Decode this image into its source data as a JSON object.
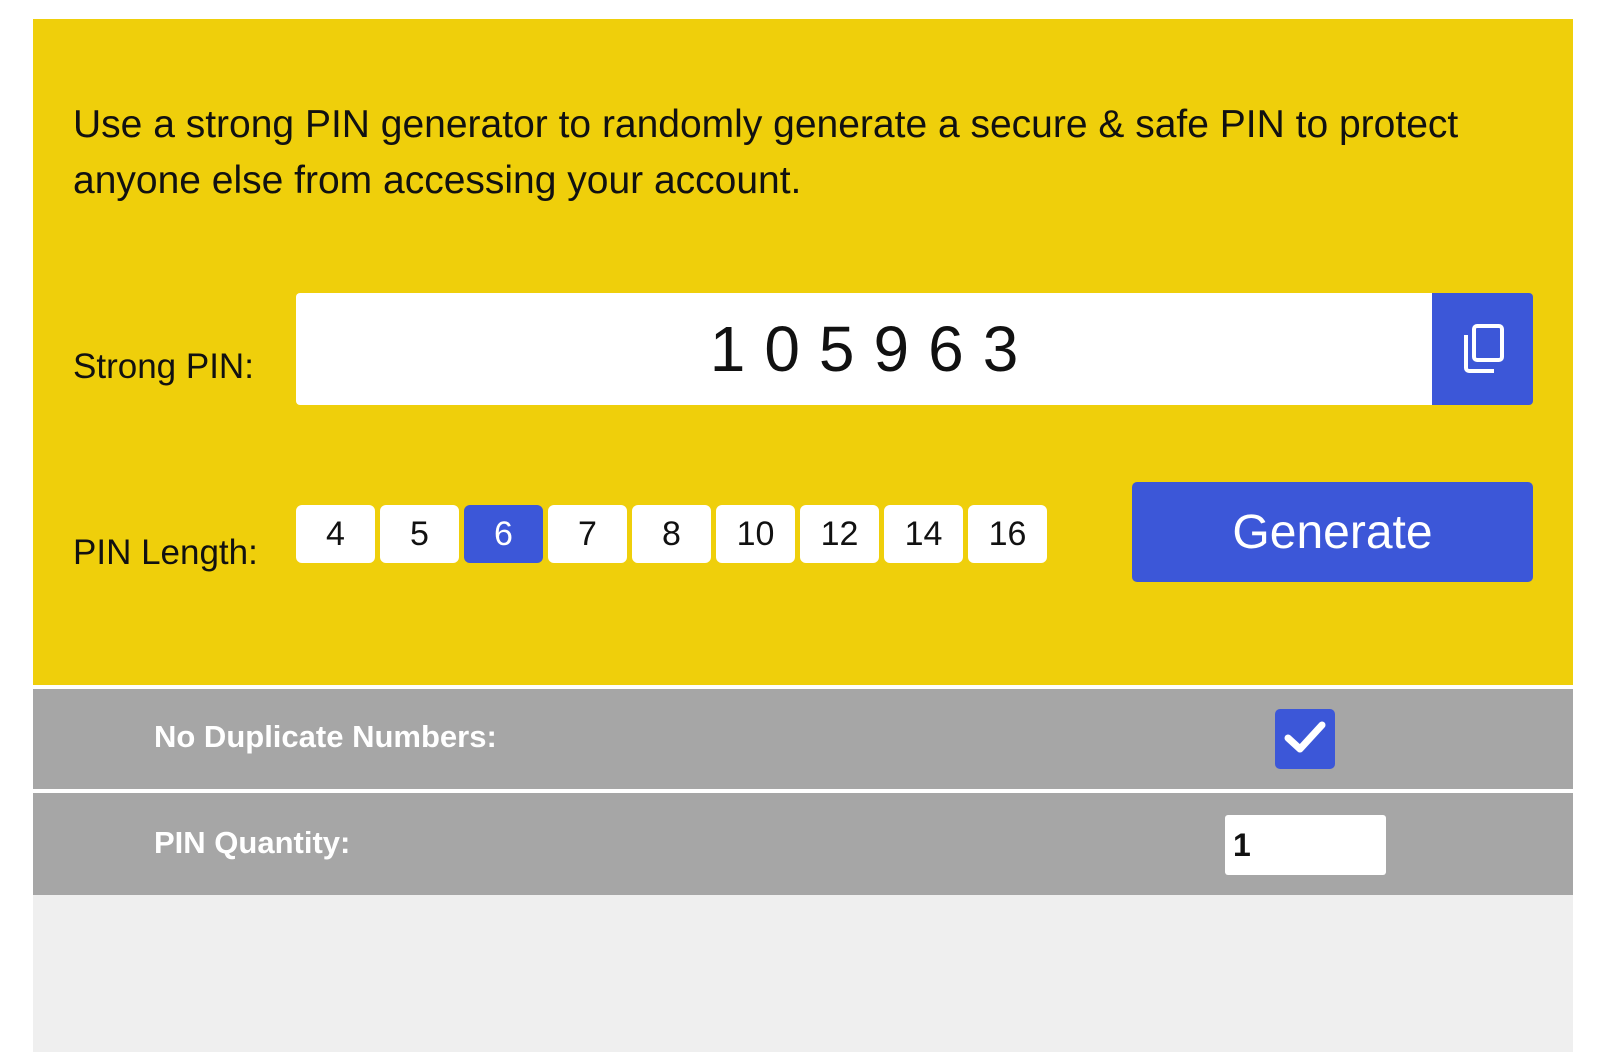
{
  "description": "Use a strong PIN generator to randomly generate a secure & safe PIN to protect anyone else from accessing your account.",
  "strong_pin": {
    "label": "Strong PIN:",
    "value": "105963",
    "copy_icon": "copy-icon"
  },
  "pin_length": {
    "label": "PIN Length:",
    "options": [
      "4",
      "5",
      "6",
      "7",
      "8",
      "10",
      "12",
      "14",
      "16"
    ],
    "selected": "6"
  },
  "generate_label": "Generate",
  "options": {
    "no_duplicates": {
      "label": "No Duplicate Numbers:",
      "checked": true,
      "icon": "checkmark-icon"
    },
    "quantity": {
      "label": "PIN Quantity:",
      "value": "1"
    }
  },
  "colors": {
    "panel": "#efcf0b",
    "accent": "#3c57d8",
    "option_row": "#a6a6a6",
    "footer": "#efefef"
  }
}
